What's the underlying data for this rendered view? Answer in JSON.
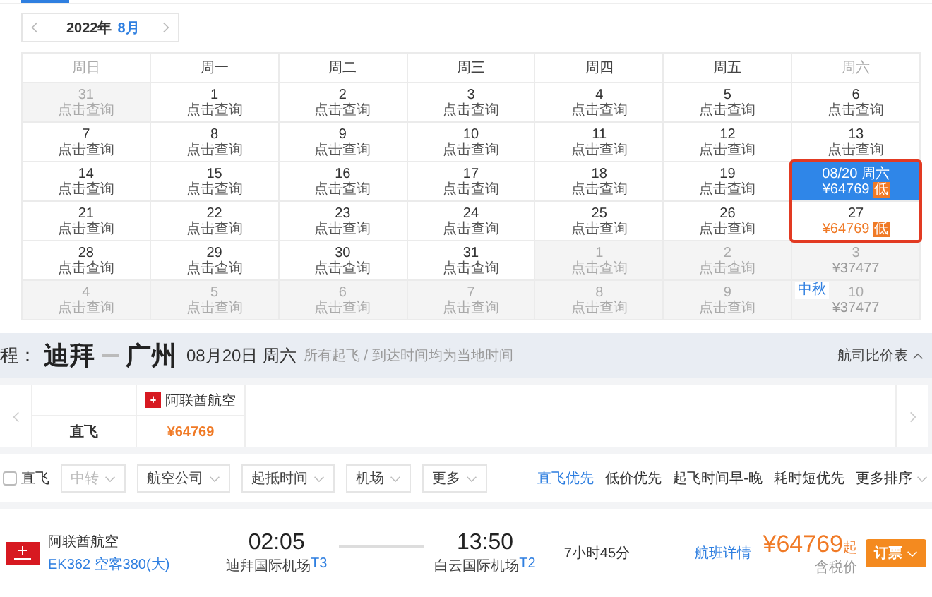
{
  "month_nav": {
    "year": "2022年",
    "month": "8月"
  },
  "calendar": {
    "weekdays": [
      {
        "label": "周日",
        "muted": true
      },
      {
        "label": "周一",
        "muted": false
      },
      {
        "label": "周二",
        "muted": false
      },
      {
        "label": "周三",
        "muted": false
      },
      {
        "label": "周四",
        "muted": false
      },
      {
        "label": "周五",
        "muted": false
      },
      {
        "label": "周六",
        "muted": true
      }
    ],
    "weeks": [
      [
        {
          "day": "31",
          "note": "点击查询",
          "kind": "query",
          "muted": true,
          "selected": false,
          "highlighted": false
        },
        {
          "day": "1",
          "note": "点击查询",
          "kind": "query",
          "muted": false,
          "selected": false,
          "highlighted": false
        },
        {
          "day": "2",
          "note": "点击查询",
          "kind": "query",
          "muted": false,
          "selected": false,
          "highlighted": false
        },
        {
          "day": "3",
          "note": "点击查询",
          "kind": "query",
          "muted": false,
          "selected": false,
          "highlighted": false
        },
        {
          "day": "4",
          "note": "点击查询",
          "kind": "query",
          "muted": false,
          "selected": false,
          "highlighted": false
        },
        {
          "day": "5",
          "note": "点击查询",
          "kind": "query",
          "muted": false,
          "selected": false,
          "highlighted": false
        },
        {
          "day": "6",
          "note": "点击查询",
          "kind": "query",
          "muted": false,
          "selected": false,
          "highlighted": false
        }
      ],
      [
        {
          "day": "7",
          "note": "点击查询",
          "kind": "query",
          "muted": false,
          "selected": false,
          "highlighted": false
        },
        {
          "day": "8",
          "note": "点击查询",
          "kind": "query",
          "muted": false,
          "selected": false,
          "highlighted": false
        },
        {
          "day": "9",
          "note": "点击查询",
          "kind": "query",
          "muted": false,
          "selected": false,
          "highlighted": false
        },
        {
          "day": "10",
          "note": "点击查询",
          "kind": "query",
          "muted": false,
          "selected": false,
          "highlighted": false
        },
        {
          "day": "11",
          "note": "点击查询",
          "kind": "query",
          "muted": false,
          "selected": false,
          "highlighted": false
        },
        {
          "day": "12",
          "note": "点击查询",
          "kind": "query",
          "muted": false,
          "selected": false,
          "highlighted": false
        },
        {
          "day": "13",
          "note": "点击查询",
          "kind": "query",
          "muted": false,
          "selected": false,
          "highlighted": false
        }
      ],
      [
        {
          "day": "14",
          "note": "点击查询",
          "kind": "query",
          "muted": false,
          "selected": false,
          "highlighted": false
        },
        {
          "day": "15",
          "note": "点击查询",
          "kind": "query",
          "muted": false,
          "selected": false,
          "highlighted": false
        },
        {
          "day": "16",
          "note": "点击查询",
          "kind": "query",
          "muted": false,
          "selected": false,
          "highlighted": false
        },
        {
          "day": "17",
          "note": "点击查询",
          "kind": "query",
          "muted": false,
          "selected": false,
          "highlighted": false
        },
        {
          "day": "18",
          "note": "点击查询",
          "kind": "query",
          "muted": false,
          "selected": false,
          "highlighted": false
        },
        {
          "day": "19",
          "note": "点击查询",
          "kind": "query",
          "muted": false,
          "selected": false,
          "highlighted": false
        },
        {
          "day": "08/20 周六",
          "note": "¥64769",
          "badge": "低",
          "kind": "price",
          "muted": false,
          "selected": true,
          "highlighted": true
        }
      ],
      [
        {
          "day": "21",
          "note": "点击查询",
          "kind": "query",
          "muted": false,
          "selected": false,
          "highlighted": false
        },
        {
          "day": "22",
          "note": "点击查询",
          "kind": "query",
          "muted": false,
          "selected": false,
          "highlighted": false
        },
        {
          "day": "23",
          "note": "点击查询",
          "kind": "query",
          "muted": false,
          "selected": false,
          "highlighted": false
        },
        {
          "day": "24",
          "note": "点击查询",
          "kind": "query",
          "muted": false,
          "selected": false,
          "highlighted": false
        },
        {
          "day": "25",
          "note": "点击查询",
          "kind": "query",
          "muted": false,
          "selected": false,
          "highlighted": false
        },
        {
          "day": "26",
          "note": "点击查询",
          "kind": "query",
          "muted": false,
          "selected": false,
          "highlighted": false
        },
        {
          "day": "27",
          "note": "¥64769",
          "badge": "低",
          "kind": "price",
          "muted": false,
          "selected": false,
          "highlighted": true
        }
      ],
      [
        {
          "day": "28",
          "note": "点击查询",
          "kind": "query",
          "muted": false,
          "selected": false,
          "highlighted": false
        },
        {
          "day": "29",
          "note": "点击查询",
          "kind": "query",
          "muted": false,
          "selected": false,
          "highlighted": false
        },
        {
          "day": "30",
          "note": "点击查询",
          "kind": "query",
          "muted": false,
          "selected": false,
          "highlighted": false
        },
        {
          "day": "31",
          "note": "点击查询",
          "kind": "query",
          "muted": false,
          "selected": false,
          "highlighted": false
        },
        {
          "day": "1",
          "note": "点击查询",
          "kind": "query",
          "muted": true,
          "selected": false,
          "highlighted": false
        },
        {
          "day": "2",
          "note": "点击查询",
          "kind": "query",
          "muted": true,
          "selected": false,
          "highlighted": false
        },
        {
          "day": "3",
          "note": "¥37477",
          "kind": "price",
          "muted": true,
          "selected": false,
          "highlighted": false
        }
      ],
      [
        {
          "day": "4",
          "note": "点击查询",
          "kind": "query",
          "muted": true,
          "selected": false,
          "highlighted": false
        },
        {
          "day": "5",
          "note": "点击查询",
          "kind": "query",
          "muted": true,
          "selected": false,
          "highlighted": false
        },
        {
          "day": "6",
          "note": "点击查询",
          "kind": "query",
          "muted": true,
          "selected": false,
          "highlighted": false
        },
        {
          "day": "7",
          "note": "点击查询",
          "kind": "query",
          "muted": true,
          "selected": false,
          "highlighted": false
        },
        {
          "day": "8",
          "note": "点击查询",
          "kind": "query",
          "muted": true,
          "selected": false,
          "highlighted": false
        },
        {
          "day": "9",
          "note": "点击查询",
          "kind": "query",
          "muted": true,
          "selected": false,
          "highlighted": false
        },
        {
          "day": "10",
          "note": "¥37477",
          "tag": "中秋",
          "kind": "price",
          "muted": true,
          "selected": false,
          "highlighted": false
        }
      ]
    ]
  },
  "route": {
    "prefix": "程：",
    "from": "迪拜",
    "to": "广州",
    "date": "08月20日 周六",
    "hint": "所有起飞 / 到达时间均为当地时间",
    "compare_toggle": "航司比价表"
  },
  "compare_table": {
    "airline": "阿联酋航空",
    "rows": [
      {
        "label": "直飞",
        "price": "¥64769"
      }
    ]
  },
  "filters": {
    "direct": {
      "label": "直飞",
      "checked": false
    },
    "dropdowns": [
      {
        "label": "中转",
        "disabled": true
      },
      {
        "label": "航空公司",
        "disabled": false
      },
      {
        "label": "起抵时间",
        "disabled": false
      },
      {
        "label": "机场",
        "disabled": false
      },
      {
        "label": "更多",
        "disabled": false
      }
    ],
    "sorts": [
      {
        "label": "直飞优先",
        "selected": true,
        "kind": "option"
      },
      {
        "label": "低价优先",
        "selected": false,
        "kind": "option"
      },
      {
        "label": "起飞时间早-晚",
        "selected": false,
        "kind": "option"
      },
      {
        "label": "耗时短优先",
        "selected": false,
        "kind": "option"
      },
      {
        "label": "更多排序",
        "selected": false,
        "kind": "dropdown"
      }
    ]
  },
  "flight": {
    "airline": "阿联酋航空",
    "flight_no": "EK362 空客380(大)",
    "depart_time": "02:05",
    "depart_airport": "迪拜国际机场",
    "depart_terminal": "T3",
    "arrive_time": "13:50",
    "arrive_airport": "白云国际机场",
    "arrive_terminal": "T2",
    "duration": "7小时45分",
    "details_link": "航班详情",
    "price": "¥64769",
    "price_suffix": "起",
    "price_note": "含税价",
    "book_button": "订票"
  }
}
